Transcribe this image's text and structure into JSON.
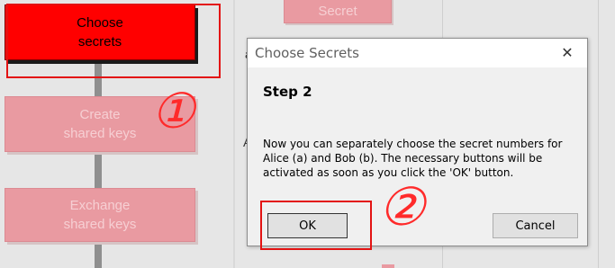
{
  "background": {
    "steps": [
      {
        "label": "Choose\nsecrets",
        "state": "active"
      },
      {
        "label": "Create\nshared keys",
        "state": "disabled"
      },
      {
        "label": "Exchange\nshared keys",
        "state": "disabled"
      }
    ],
    "secret_button_label": "Secret",
    "partial_letters": [
      "a",
      "A"
    ],
    "colors": {
      "active": "#ff0000",
      "disabled": "#e99aa1",
      "annotation": "#e31313"
    }
  },
  "annotations": {
    "marker_1": "①",
    "marker_2": "②"
  },
  "dialog": {
    "title": "Choose Secrets",
    "close_icon": "close-icon",
    "step_title": "Step 2",
    "message": "Now you can separately choose the secret numbers for Alice (a) and Bob (b). The necessary buttons will be activated as soon as you click the 'OK' button.",
    "ok_label": "OK",
    "cancel_label": "Cancel"
  }
}
